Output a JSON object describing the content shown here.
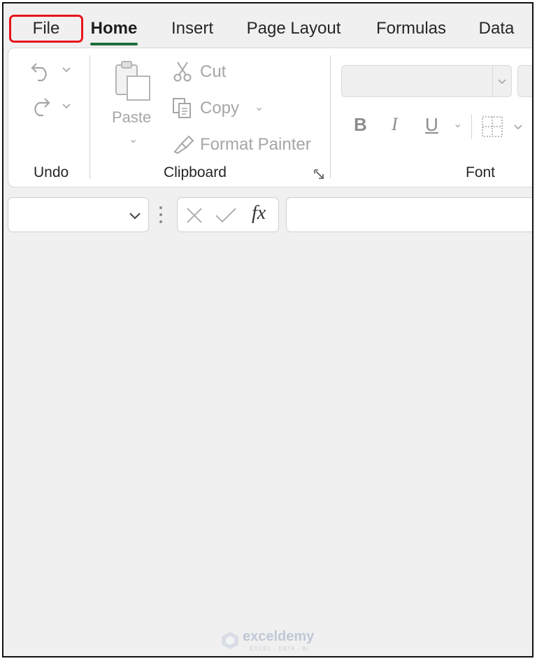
{
  "tabs": {
    "file": "File",
    "home": "Home",
    "insert": "Insert",
    "page_layout": "Page Layout",
    "formulas": "Formulas",
    "data": "Data"
  },
  "ribbon": {
    "undo_group": {
      "label": "Undo"
    },
    "clipboard_group": {
      "label": "Clipboard",
      "paste": "Paste",
      "cut": "Cut",
      "copy": "Copy",
      "format_painter": "Format Painter"
    },
    "font_group": {
      "label": "Font",
      "bold": "B",
      "italic": "I",
      "underline": "U"
    }
  },
  "formula_bar": {
    "fx": "fx"
  },
  "watermark": {
    "brand": "exceldemy",
    "tagline": "EXCEL · DATA · BI"
  },
  "colors": {
    "highlight": "#e8141b",
    "home_underline": "#1e6e3c",
    "background": "#f0f0f0"
  }
}
